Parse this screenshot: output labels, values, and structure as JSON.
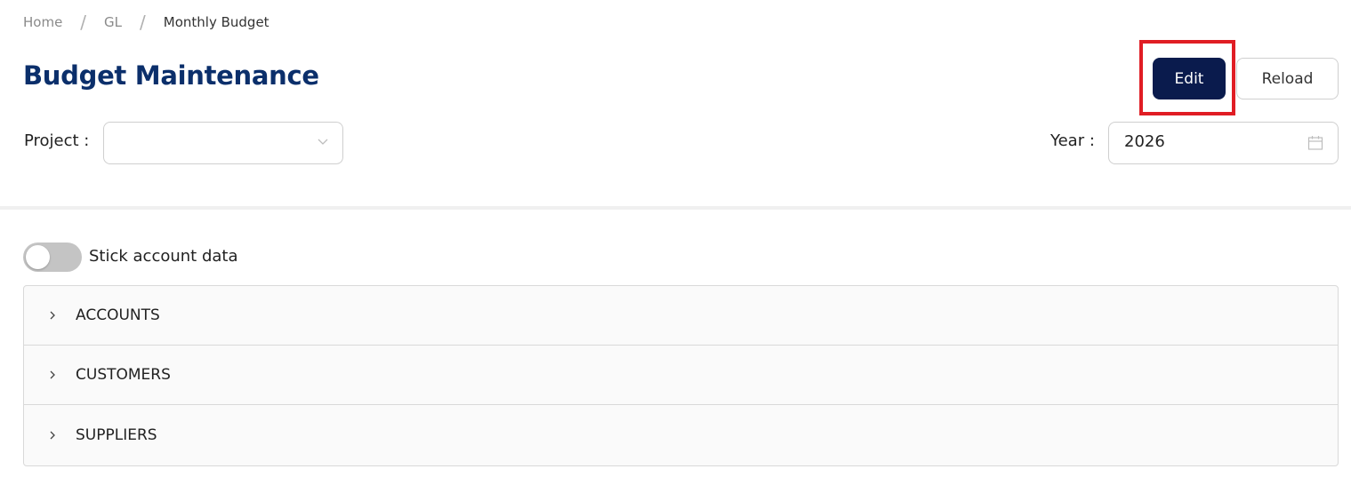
{
  "breadcrumb": {
    "items": [
      "Home",
      "GL",
      "Monthly Budget"
    ],
    "separator": "/"
  },
  "page": {
    "title": "Budget Maintenance"
  },
  "actions": {
    "edit_label": "Edit",
    "reload_label": "Reload"
  },
  "filters": {
    "project_label": "Project :",
    "project_value": "",
    "year_label": "Year :",
    "year_value": "2026"
  },
  "toggle": {
    "label": "Stick account data",
    "checked": false
  },
  "panels": [
    {
      "label": "ACCOUNTS"
    },
    {
      "label": "CUSTOMERS"
    },
    {
      "label": "SUPPLIERS"
    }
  ],
  "icons": {
    "select": "chevron-down-icon",
    "datepicker": "calendar-icon",
    "panel": "chevron-right-icon"
  },
  "colors": {
    "title": "#0b2f6b",
    "primary_button": "#0a1b4d",
    "highlight": "#e01d24"
  }
}
